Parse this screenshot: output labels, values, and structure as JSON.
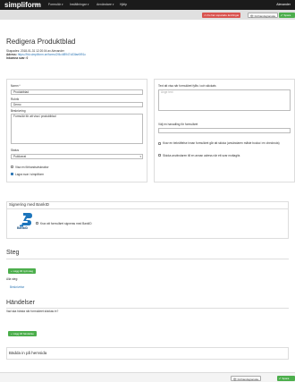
{
  "app": {
    "brand": "simpliform",
    "user": "Alexander"
  },
  "nav": [
    {
      "label": "Hem"
    },
    {
      "label": "Formulär",
      "caret": "▾"
    },
    {
      "label": "Inställningar",
      "caret": "▾"
    },
    {
      "label": "Användare",
      "caret": "▾"
    },
    {
      "label": "Hjälp"
    }
  ],
  "actionbar": {
    "unsaved": "⚠ Du har osparade ändringar",
    "preview": "👁 Förhandsgranska",
    "save": "✔ Spara"
  },
  "page": {
    "title": "Redigera Produktblad",
    "saved": "Skapades: 2018-01-31 12:20:04 av Alexander",
    "address_label": "Adress:",
    "address_url": "https://ibk.simpliform.se/forms/2f4c4f8947c83fae5f91c",
    "responses": "Inkomna svar: 0"
  },
  "form": {
    "name_label": "Namn *",
    "name_value": "Produktblad",
    "heading_label": "Rubrik",
    "heading_value": "Demo",
    "description_label": "Beskrivning",
    "description_value": "Formulär för att visa i produktblad",
    "status_label": "Status",
    "status_value": "Publicerat",
    "status_caret": "▾",
    "show_preview_label": "Visa en förhandsvisknabor",
    "save_in_label": "Lagra svar i simpliform",
    "done_text_label": "Text att visa när formuläret fyllts i och skickats",
    "done_text_placeholder": "Ange text",
    "redirect_label": "Välj en hanadling för formuläret",
    "confirm_label": "Krav en bekräftelse innan formuläret går att skicka (användaren måste bocka i en checkruta)",
    "email_copy_label": "Skicka användaren till en annan adress när ett svar mottagits"
  },
  "bankid": {
    "section_title": "Signering med BankID",
    "logo_text": "BankID",
    "checkbox_label": "Krav att formuläret signeras med BankID"
  },
  "steps": {
    "title": "Steg",
    "add_button": "+ Lägg till nytt steg",
    "steps_label": "Alla steg:",
    "step_link": "Beskrivelse"
  },
  "events": {
    "title": "Händelser",
    "subtitle": "Vad ska hända när formuläret skickas in?",
    "add_button": "+ Lägg till händelse",
    "sub_title": "Bädda in på hemsida"
  },
  "bottombar": {
    "preview": "👁 Förhandsgranska",
    "save": "✔ Spara"
  },
  "colors": {
    "accent": "#4cae4c",
    "danger": "#d9534f",
    "link": "#337ab7",
    "topbar": "#1b1b1b"
  }
}
